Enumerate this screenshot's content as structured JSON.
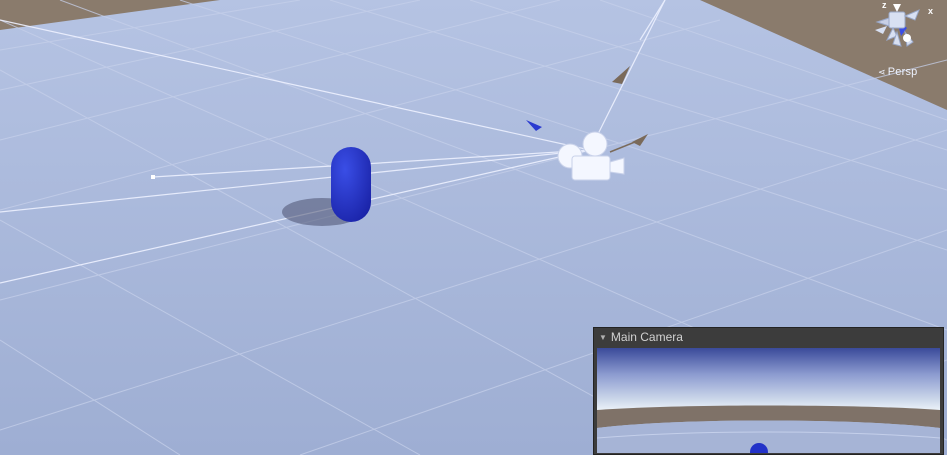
{
  "scene": {
    "view_mode": "Persp",
    "gizmo_axes": {
      "x": "x",
      "z": "z"
    }
  },
  "camera_preview": {
    "title": "Main Camera",
    "foldout_glyph": "▼"
  },
  "colors": {
    "ground": "#a6b4d6",
    "grid_line": "#c2cde6",
    "background": "#8a7b6c",
    "capsule": "#2332c8",
    "camera_icon": "#f4f7ff",
    "frustum_line": "#e6ecff",
    "preview_sky": "#d8e2ee",
    "preview_ground": "#7f7268"
  },
  "icons": {
    "camera": "camera-gizmo-icon",
    "light": "directional-light-arrow-icon",
    "gizmo": "scene-orientation-gizmo-icon"
  }
}
